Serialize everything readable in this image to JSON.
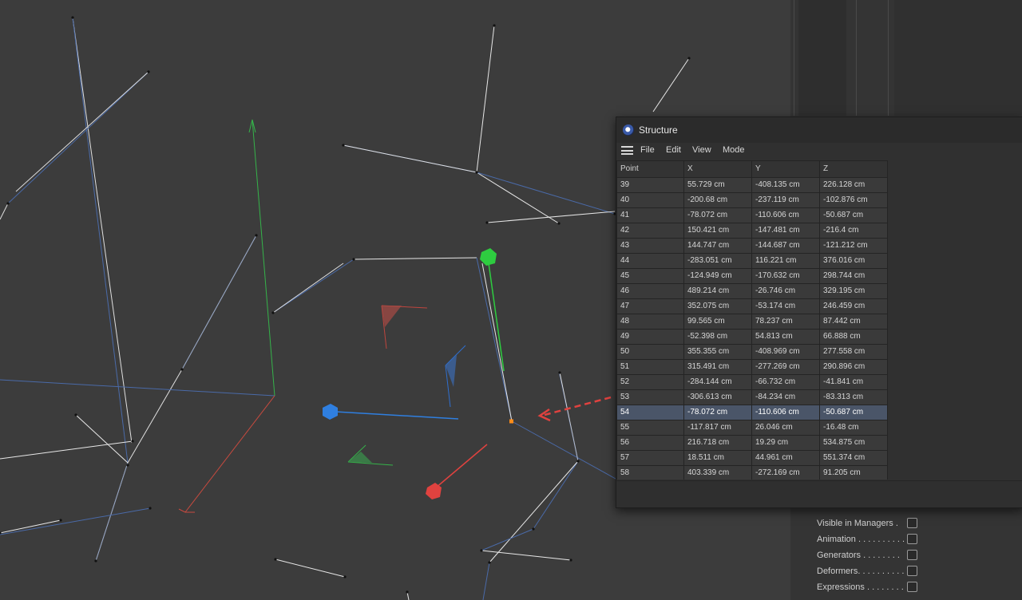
{
  "window": {
    "title": "Structure",
    "menu": [
      "File",
      "Edit",
      "View",
      "Mode"
    ]
  },
  "table": {
    "columns": [
      "Point",
      "X",
      "Y",
      "Z"
    ],
    "selected_point": "54",
    "rows": [
      [
        "39",
        "55.729 cm",
        "-408.135 cm",
        "226.128 cm"
      ],
      [
        "40",
        "-200.68 cm",
        "-237.119 cm",
        "-102.876 cm"
      ],
      [
        "41",
        "-78.072 cm",
        "-110.606 cm",
        "-50.687 cm"
      ],
      [
        "42",
        "150.421 cm",
        "-147.481 cm",
        "-216.4 cm"
      ],
      [
        "43",
        "144.747 cm",
        "-144.687 cm",
        "-121.212 cm"
      ],
      [
        "44",
        "-283.051 cm",
        "116.221 cm",
        "376.016 cm"
      ],
      [
        "45",
        "-124.949 cm",
        "-170.632 cm",
        "298.744 cm"
      ],
      [
        "46",
        "489.214 cm",
        "-26.746 cm",
        "329.195 cm"
      ],
      [
        "47",
        "352.075 cm",
        "-53.174 cm",
        "246.459 cm"
      ],
      [
        "48",
        "99.565 cm",
        "78.237 cm",
        "87.442 cm"
      ],
      [
        "49",
        "-52.398 cm",
        "54.813 cm",
        "66.888 cm"
      ],
      [
        "50",
        "355.355 cm",
        "-408.969 cm",
        "277.558 cm"
      ],
      [
        "51",
        "315.491 cm",
        "-277.269 cm",
        "290.896 cm"
      ],
      [
        "52",
        "-284.144 cm",
        "-66.732 cm",
        "-41.841 cm"
      ],
      [
        "53",
        "-306.613 cm",
        "-84.234 cm",
        "-83.313 cm"
      ],
      [
        "54",
        "-78.072 cm",
        "-110.606 cm",
        "-50.687 cm"
      ],
      [
        "55",
        "-117.817 cm",
        "26.046 cm",
        "-16.48 cm"
      ],
      [
        "56",
        "216.718 cm",
        "19.29 cm",
        "534.875 cm"
      ],
      [
        "57",
        "18.511 cm",
        "44.961 cm",
        "551.374 cm"
      ],
      [
        "58",
        "403.339 cm",
        "-272.169 cm",
        "91.205 cm"
      ]
    ]
  },
  "filters": [
    {
      "label": "Visible in Managers .",
      "checked": false
    },
    {
      "label": "Animation . . . . . . . . . .",
      "checked": false
    },
    {
      "label": "Generators  . . . . . . . .",
      "checked": false
    },
    {
      "label": "Deformers. . . . . . . . . .",
      "checked": false
    },
    {
      "label": "Expressions . . . . . . . .",
      "checked": false
    }
  ],
  "colors": {
    "viewport_bg": "#3c3c3c",
    "axis_x": "#e0423f",
    "axis_y": "#2ecc40",
    "axis_z": "#2f7fe0",
    "edge_blue": "#4a6aa8",
    "edge_white": "#e8e8e8",
    "selected_point": "#ff8c1a",
    "selection_row": "#4a5568"
  },
  "icons": [
    "app-logo-icon",
    "hamburger-menu-icon",
    "dashed-arrow-icon"
  ]
}
